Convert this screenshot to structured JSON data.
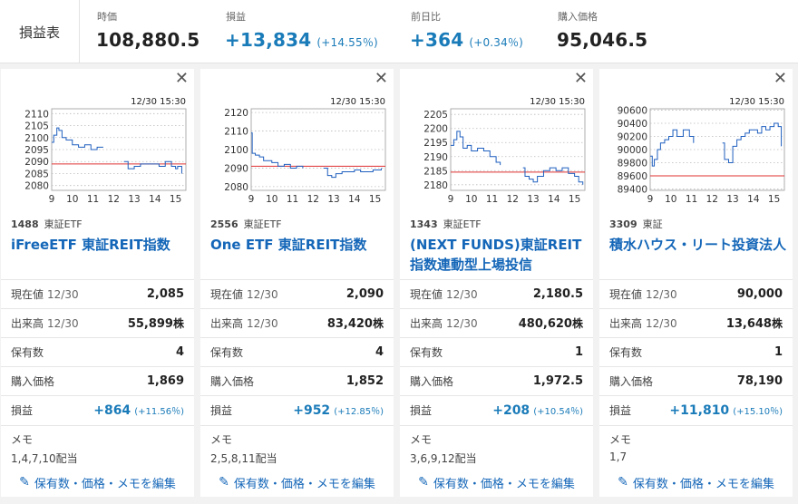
{
  "summary": {
    "title": "損益表",
    "price_label": "時価",
    "price_value": "108,880.5",
    "pl_label": "損益",
    "pl_value": "+13,834",
    "pl_pct": "(+14.55％)",
    "day_label": "前日比",
    "day_value": "+364",
    "day_pct": "(+0.34％)",
    "cost_label": "購入価格",
    "cost_value": "95,046.5"
  },
  "labels": {
    "close": "✕",
    "now": "現在値",
    "volume": "出来高",
    "held": "保有数",
    "cost": "購入価格",
    "pl": "損益",
    "memo": "メモ",
    "edit": "保有数・価格・メモを編集",
    "date": "12/30",
    "shares_unit": "株"
  },
  "chart_data": [
    {
      "type": "line",
      "timestamp": "12/30 15:30",
      "x_ticks": [
        "9",
        "10",
        "11",
        "12",
        "13",
        "14",
        "15"
      ],
      "y_ticks": [
        "2110",
        "2105",
        "2100",
        "2095",
        "2090",
        "2085",
        "2080"
      ],
      "ylim": [
        2078,
        2112
      ],
      "xlim": [
        9,
        15.5
      ],
      "reference_line": 2089,
      "points": [
        [
          9,
          2098
        ],
        [
          9.1,
          2101
        ],
        [
          9.25,
          2104
        ],
        [
          9.35,
          2103
        ],
        [
          9.5,
          2100
        ],
        [
          9.7,
          2099
        ],
        [
          10,
          2097
        ],
        [
          10.3,
          2096
        ],
        [
          10.6,
          2097
        ],
        [
          10.9,
          2095
        ],
        [
          11.2,
          2096
        ],
        [
          11.5,
          2096
        ],
        [
          12.5,
          2090
        ],
        [
          12.7,
          2087
        ],
        [
          13,
          2088
        ],
        [
          13.3,
          2089
        ],
        [
          13.6,
          2089
        ],
        [
          13.9,
          2089
        ],
        [
          14.2,
          2088
        ],
        [
          14.5,
          2090
        ],
        [
          14.8,
          2088
        ],
        [
          15,
          2087
        ],
        [
          15.1,
          2088
        ],
        [
          15.3,
          2085
        ]
      ],
      "gap_after_x": 11.5,
      "line_color": "#1f5fbf",
      "ref_color": "#e03030"
    },
    {
      "type": "line",
      "timestamp": "12/30 15:30",
      "x_ticks": [
        "9",
        "10",
        "11",
        "12",
        "13",
        "14",
        "15"
      ],
      "y_ticks": [
        "2120",
        "2110",
        "2100",
        "2090",
        "2080"
      ],
      "ylim": [
        2078,
        2122
      ],
      "xlim": [
        9,
        15.5
      ],
      "reference_line": 2091,
      "points": [
        [
          9,
          2109
        ],
        [
          9.05,
          2098
        ],
        [
          9.2,
          2097
        ],
        [
          9.4,
          2096
        ],
        [
          9.6,
          2094
        ],
        [
          9.8,
          2094
        ],
        [
          10,
          2093
        ],
        [
          10.3,
          2091
        ],
        [
          10.6,
          2092
        ],
        [
          10.9,
          2090
        ],
        [
          11.2,
          2091
        ],
        [
          11.5,
          2090
        ],
        [
          12.5,
          2090
        ],
        [
          12.7,
          2086
        ],
        [
          12.9,
          2085
        ],
        [
          13.1,
          2087
        ],
        [
          13.4,
          2088
        ],
        [
          13.7,
          2088
        ],
        [
          14,
          2089
        ],
        [
          14.3,
          2088
        ],
        [
          14.6,
          2088
        ],
        [
          14.9,
          2089
        ],
        [
          15.1,
          2089
        ],
        [
          15.3,
          2090
        ]
      ],
      "gap_after_x": 11.5,
      "line_color": "#1f5fbf",
      "ref_color": "#e03030"
    },
    {
      "type": "line",
      "timestamp": "12/30 15:30",
      "x_ticks": [
        "9",
        "10",
        "11",
        "12",
        "13",
        "14",
        "15"
      ],
      "y_ticks": [
        "2205",
        "2200",
        "2195",
        "2190",
        "2185",
        "2180"
      ],
      "ylim": [
        2178,
        2207
      ],
      "xlim": [
        9,
        15.5
      ],
      "reference_line": 2184.5,
      "points": [
        [
          9,
          2194
        ],
        [
          9.15,
          2196
        ],
        [
          9.3,
          2199
        ],
        [
          9.45,
          2197
        ],
        [
          9.6,
          2193
        ],
        [
          9.8,
          2194
        ],
        [
          10,
          2192
        ],
        [
          10.3,
          2193
        ],
        [
          10.6,
          2192
        ],
        [
          10.9,
          2190
        ],
        [
          11.2,
          2188
        ],
        [
          11.4,
          2187
        ],
        [
          12.5,
          2186
        ],
        [
          12.6,
          2183
        ],
        [
          12.8,
          2182
        ],
        [
          13,
          2181
        ],
        [
          13.2,
          2183
        ],
        [
          13.5,
          2185
        ],
        [
          13.8,
          2186
        ],
        [
          14.1,
          2185
        ],
        [
          14.4,
          2186
        ],
        [
          14.7,
          2184
        ],
        [
          15,
          2183
        ],
        [
          15.2,
          2181
        ],
        [
          15.4,
          2180
        ]
      ],
      "gap_after_x": 11.4,
      "line_color": "#1f5fbf",
      "ref_color": "#e03030"
    },
    {
      "type": "line",
      "timestamp": "12/30 15:30",
      "x_ticks": [
        "9",
        "10",
        "11",
        "12",
        "13",
        "14",
        "15"
      ],
      "y_ticks": [
        "90600",
        "90400",
        "90200",
        "90000",
        "89800",
        "89600",
        "89400"
      ],
      "ylim": [
        89380,
        90620
      ],
      "xlim": [
        9,
        15.5
      ],
      "reference_line": 89600,
      "points": [
        [
          9,
          89900
        ],
        [
          9.1,
          89750
        ],
        [
          9.2,
          89850
        ],
        [
          9.35,
          90000
        ],
        [
          9.5,
          90100
        ],
        [
          9.7,
          90150
        ],
        [
          9.9,
          90200
        ],
        [
          10.1,
          90300
        ],
        [
          10.3,
          90200
        ],
        [
          10.6,
          90300
        ],
        [
          10.9,
          90200
        ],
        [
          11.1,
          90100
        ],
        [
          12.5,
          90100
        ],
        [
          12.6,
          89850
        ],
        [
          12.8,
          89800
        ],
        [
          13,
          90050
        ],
        [
          13.2,
          90150
        ],
        [
          13.4,
          90200
        ],
        [
          13.6,
          90250
        ],
        [
          13.8,
          90300
        ],
        [
          14,
          90300
        ],
        [
          14.2,
          90250
        ],
        [
          14.4,
          90350
        ],
        [
          14.6,
          90300
        ],
        [
          14.8,
          90350
        ],
        [
          15,
          90400
        ],
        [
          15.2,
          90350
        ],
        [
          15.35,
          90050
        ]
      ],
      "gap_after_x": 11.1,
      "line_color": "#1f5fbf",
      "ref_color": "#e03030"
    }
  ],
  "cards": [
    {
      "code": "1488",
      "market": "東証ETF",
      "name": "iFreeETF 東証REIT指数",
      "now": "2,085",
      "volume": "55,899",
      "held": "4",
      "cost": "1,869",
      "pl": "+864",
      "pl_pct": "(+11.56％)",
      "memo": "1,4,7,10配当"
    },
    {
      "code": "2556",
      "market": "東証ETF",
      "name": "One ETF 東証REIT指数",
      "now": "2,090",
      "volume": "83,420",
      "held": "4",
      "cost": "1,852",
      "pl": "+952",
      "pl_pct": "(+12.85％)",
      "memo": "2,5,8,11配当"
    },
    {
      "code": "1343",
      "market": "東証ETF",
      "name": "(NEXT FUNDS)東証REIT指数連動型上場投信",
      "now": "2,180.5",
      "volume": "480,620",
      "held": "1",
      "cost": "1,972.5",
      "pl": "+208",
      "pl_pct": "(+10.54％)",
      "memo": "3,6,9,12配当"
    },
    {
      "code": "3309",
      "market": "東証",
      "name": "積水ハウス・リート投資法人",
      "now": "90,000",
      "volume": "13,648",
      "held": "1",
      "cost": "78,190",
      "pl": "+11,810",
      "pl_pct": "(+15.10％)",
      "memo": "1,7"
    }
  ]
}
